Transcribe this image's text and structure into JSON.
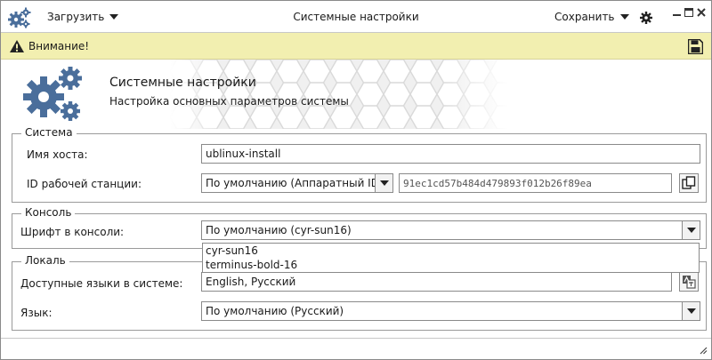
{
  "titlebar": {
    "load_label": "Загрузить",
    "title": "Системные настройки",
    "save_label": "Сохранить"
  },
  "warning": {
    "text": "Внимание!"
  },
  "header": {
    "title": "Системные настройки",
    "subtitle": "Настройка основных параметров системы"
  },
  "system": {
    "legend": "Система",
    "hostname_label": "Имя хоста:",
    "hostname_value": "ublinux-install",
    "machine_id_label": "ID рабочей станции:",
    "machine_id_mode": "По умолчанию (Аппаратный ID)",
    "machine_id_value": "91ec1cd57b484d479893f012b26f89ea"
  },
  "console": {
    "legend": "Консоль",
    "font_label": "Шрифт в консоли:",
    "font_value": "По умолчанию (cyr-sun16)",
    "font_options": [
      "cyr-sun16",
      "terminus-bold-16"
    ]
  },
  "locale": {
    "legend": "Локаль",
    "available_label": "Доступные языки в системе:",
    "available_value": "English, Русский",
    "language_label": "Язык:",
    "language_value": "По умолчанию (Русский)"
  },
  "colors": {
    "accent_icon": "#4a6e9b",
    "warning_bg": "#f2efb0"
  },
  "icons": [
    "gears-icon",
    "chevron-down-icon",
    "gear-icon",
    "minimize-icon",
    "maximize-icon",
    "close-icon",
    "warning-icon",
    "save-icon",
    "copy-icon",
    "language-icon",
    "resize-grip-icon"
  ]
}
